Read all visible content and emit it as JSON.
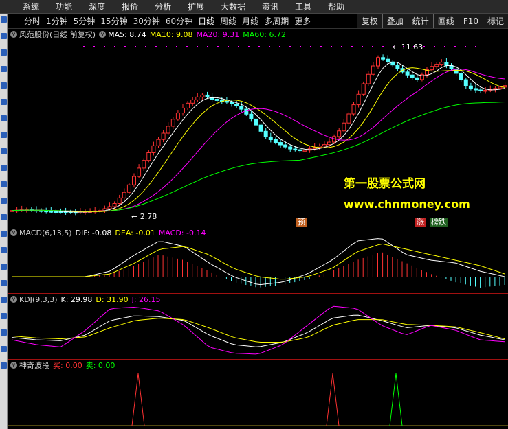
{
  "menu": [
    "系统",
    "功能",
    "深度",
    "报价",
    "分析",
    "扩展",
    "大数据",
    "资讯",
    "工具",
    "帮助"
  ],
  "periods": [
    "分时",
    "1分钟",
    "5分钟",
    "15分钟",
    "30分钟",
    "60分钟",
    "日线",
    "周线",
    "月线",
    "多周期",
    "更多"
  ],
  "active_period": "日线",
  "right_buttons": [
    "复权",
    "叠加",
    "统计",
    "画线",
    "F10",
    "标记"
  ],
  "main": {
    "stock_title": "风范股份(日线 前复权)",
    "ma5": "MA5: 8.74",
    "ma10": "MA10: 9.08",
    "ma20": "MA20: 9.31",
    "ma60": "MA60: 6.72",
    "high_label": "11.63",
    "low_label": "2.78",
    "flag_pre": "预",
    "flag_zhang": "涨",
    "flag_diedie": "榜跌"
  },
  "macd": {
    "title": "MACD(6,13,5)",
    "dif": "DIF: -0.08",
    "dea": "DEA: -0.01",
    "macd": "MACD: -0.14"
  },
  "kdj": {
    "title": "KDJ(9,3,3)",
    "k": "K: 29.98",
    "d": "D: 31.90",
    "j": "J: 26.15"
  },
  "wave": {
    "title": "神奇波段",
    "buy": "买: 0.00",
    "sell": "卖: 0.00"
  },
  "watermark": {
    "line1": "第一股票公式网",
    "line2": "www.chnmoney.com"
  },
  "colors": {
    "up": "#ff3232",
    "down": "#54ffff",
    "ma5": "#ffffff",
    "ma10": "#ffff00",
    "ma20": "#ff00ff",
    "ma60": "#00ff00"
  }
}
